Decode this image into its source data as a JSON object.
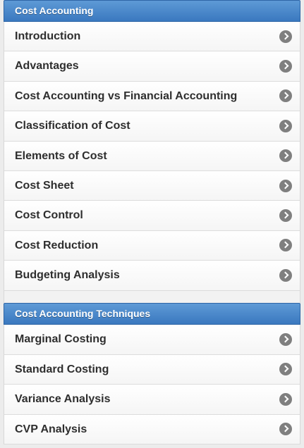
{
  "sections": [
    {
      "title": "Cost Accounting",
      "items": [
        {
          "label": "Introduction"
        },
        {
          "label": "Advantages"
        },
        {
          "label": "Cost Accounting vs Financial Accounting"
        },
        {
          "label": "Classification of Cost"
        },
        {
          "label": "Elements of Cost"
        },
        {
          "label": "Cost Sheet"
        },
        {
          "label": "Cost Control"
        },
        {
          "label": "Cost Reduction"
        },
        {
          "label": "Budgeting Analysis"
        }
      ]
    },
    {
      "title": "Cost Accounting Techniques",
      "items": [
        {
          "label": "Marginal Costing"
        },
        {
          "label": "Standard Costing"
        },
        {
          "label": "Variance Analysis"
        },
        {
          "label": "CVP Analysis"
        }
      ]
    }
  ],
  "icons": {
    "item_arrow": "chevron-right-circle-icon"
  },
  "colors": {
    "header_top": "#5e9ad6",
    "header_bottom": "#3a78bf",
    "item_text": "#2e2e2e",
    "arrow_bg": "#7f7f7f"
  }
}
